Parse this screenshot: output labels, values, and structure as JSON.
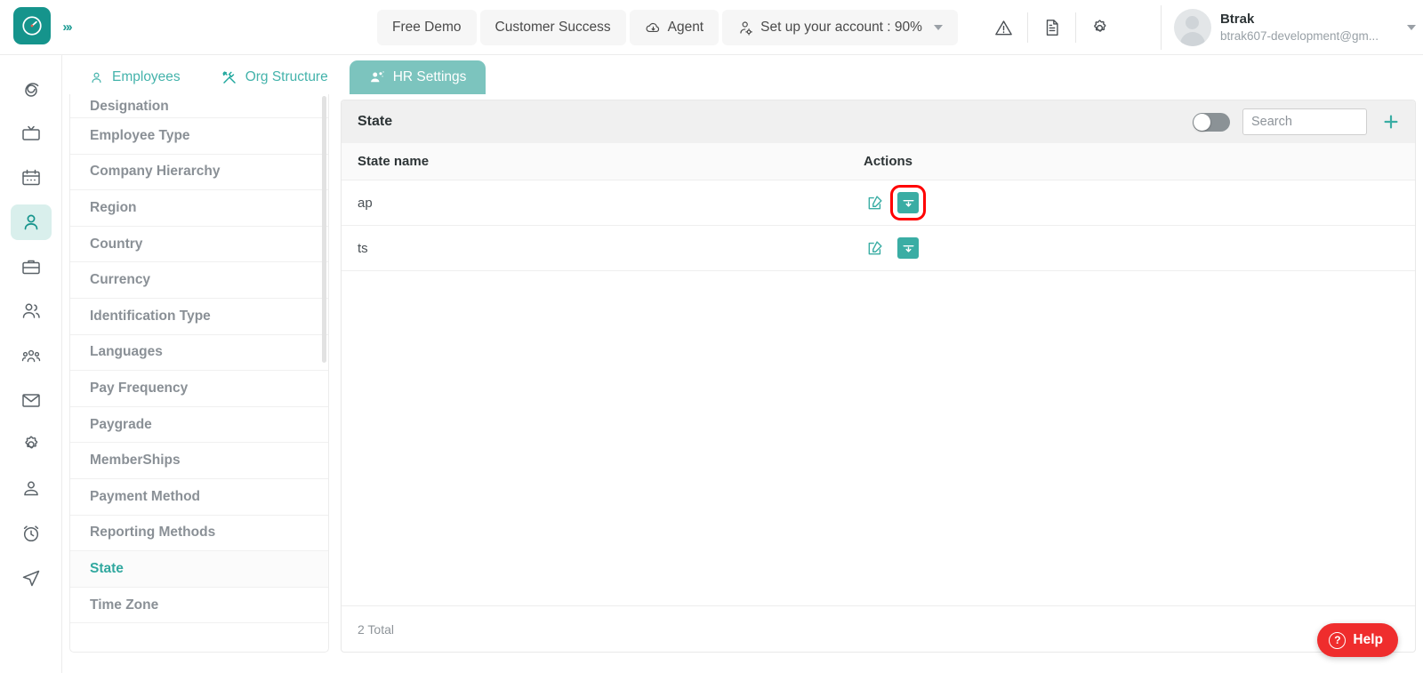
{
  "brand": {
    "logo_icon": "clock-icon",
    "expander_icon": "chevrons-right-icon",
    "accent": "#15948c",
    "accent_light": "#3aada4",
    "tab_active_bg": "#7cc4be"
  },
  "topbar": {
    "pills": [
      {
        "label": "Free Demo",
        "icon": null
      },
      {
        "label": "Customer Success",
        "icon": null
      },
      {
        "label": "Agent",
        "icon": "cloud-download-icon"
      },
      {
        "label": "Set up your account : 90%",
        "icon": "user-gear-icon",
        "caret": true
      }
    ],
    "icons": [
      "warning-triangle-icon",
      "document-icon",
      "gear-icon"
    ],
    "profile": {
      "name": "Btrak",
      "email": "btrak607-development@gm...",
      "avatar_icon": "avatar-icon",
      "caret_icon": "caret-down-icon"
    }
  },
  "rail": {
    "items": [
      {
        "name": "dashboard",
        "icon": "spiral-icon",
        "active": false
      },
      {
        "name": "projects",
        "icon": "tv-icon",
        "active": false
      },
      {
        "name": "calendar",
        "icon": "calendar-icon",
        "active": false
      },
      {
        "name": "hr",
        "icon": "user-icon",
        "active": true
      },
      {
        "name": "briefcase",
        "icon": "briefcase-icon",
        "active": false
      },
      {
        "name": "teams",
        "icon": "users-icon",
        "active": false
      },
      {
        "name": "groups",
        "icon": "group-icon",
        "active": false
      },
      {
        "name": "mail",
        "icon": "mail-icon",
        "active": false
      },
      {
        "name": "settings",
        "icon": "gear-icon",
        "active": false
      },
      {
        "name": "profile",
        "icon": "person-icon",
        "active": false
      },
      {
        "name": "timer",
        "icon": "alarm-clock-icon",
        "active": false
      },
      {
        "name": "send",
        "icon": "send-icon",
        "active": false
      }
    ]
  },
  "tabs": [
    {
      "label": "Employees",
      "icon": "user-icon",
      "active": false
    },
    {
      "label": "Org Structure",
      "icon": "tools-icon",
      "active": false
    },
    {
      "label": "HR Settings",
      "icon": "users-gear-icon",
      "active": true
    }
  ],
  "settings_menu": {
    "items": [
      {
        "label": "Designation",
        "active": false,
        "clipped": true
      },
      {
        "label": "Employee Type",
        "active": false
      },
      {
        "label": "Company Hierarchy",
        "active": false
      },
      {
        "label": "Region",
        "active": false
      },
      {
        "label": "Country",
        "active": false
      },
      {
        "label": "Currency",
        "active": false
      },
      {
        "label": "Identification Type",
        "active": false
      },
      {
        "label": "Languages",
        "active": false
      },
      {
        "label": "Pay Frequency",
        "active": false
      },
      {
        "label": "Paygrade",
        "active": false
      },
      {
        "label": "MemberShips",
        "active": false
      },
      {
        "label": "Payment Method",
        "active": false
      },
      {
        "label": "Reporting Methods",
        "active": false
      },
      {
        "label": "State",
        "active": true
      },
      {
        "label": "Time Zone",
        "active": false
      }
    ]
  },
  "panel": {
    "title": "State",
    "toggle_on": false,
    "search": {
      "value": "",
      "placeholder": "Search"
    },
    "add_label": "+",
    "columns": {
      "name": "State name",
      "actions": "Actions"
    },
    "rows": [
      {
        "name": "ap",
        "edit_icon": "edit-pencil-icon",
        "archive_icon": "archive-down-icon",
        "highlighted": true
      },
      {
        "name": "ts",
        "edit_icon": "edit-pencil-icon",
        "archive_icon": "archive-down-icon",
        "highlighted": false
      }
    ],
    "footer": "2 Total"
  },
  "help": {
    "label": "Help",
    "icon": "question-circle-icon",
    "color": "#ef2d2d"
  }
}
